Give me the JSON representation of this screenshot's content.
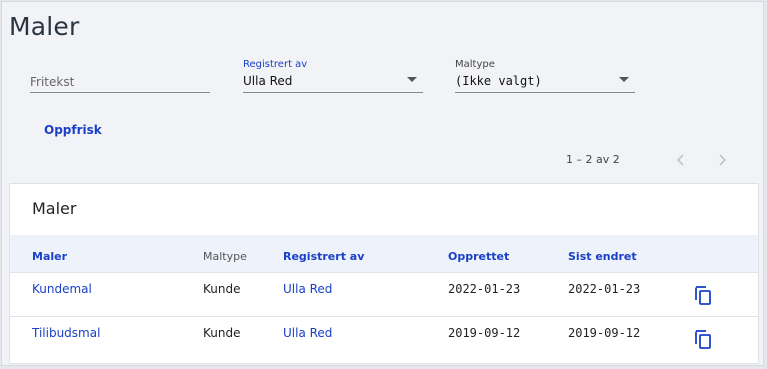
{
  "page": {
    "title": "Maler"
  },
  "filters": {
    "fritekst": {
      "placeholder": "Fritekst",
      "value": ""
    },
    "registrert_av": {
      "label": "Registrert av",
      "value": "Ulla Red"
    },
    "maltype": {
      "label": "Maltype",
      "value": "(Ikke valgt)"
    }
  },
  "actions": {
    "refresh_label": "Oppfrisk"
  },
  "pagination": {
    "info": "1 – 2 av 2",
    "prev_icon": "chevron-left-icon",
    "next_icon": "chevron-right-icon"
  },
  "table": {
    "title": "Maler",
    "columns": [
      "Maler",
      "Maltype",
      "Registrert av",
      "Opprettet",
      "Sist endret"
    ],
    "rows": [
      {
        "maler": "Kundemal",
        "maltype": "Kunde",
        "registrert_av": "Ulla Red",
        "opprettet": "2022-01-23",
        "sist_endret": "2022-01-23",
        "action_icon": "copy-icon"
      },
      {
        "maler": "Tilibudsmal",
        "maltype": "Kunde",
        "registrert_av": "Ulla Red",
        "opprettet": "2019-09-12",
        "sist_endret": "2019-09-12",
        "action_icon": "copy-icon"
      }
    ]
  },
  "colors": {
    "accent": "#1a40c8",
    "background": "#f2f3f7",
    "header_row": "#eef2fb"
  }
}
